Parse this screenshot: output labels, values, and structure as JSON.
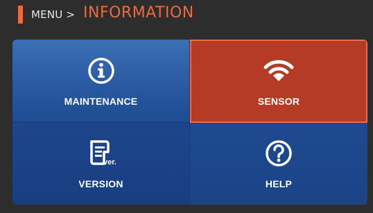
{
  "header": {
    "breadcrumb": "MENU >",
    "title": "INFORMATION",
    "accent_color": "#ef6a3a"
  },
  "tiles": [
    {
      "label": "MAINTENANCE",
      "icon": "info-icon",
      "selected": false
    },
    {
      "label": "SENSOR",
      "icon": "wifi-signal-icon",
      "selected": true
    },
    {
      "label": "VERSION",
      "icon": "version-document-icon",
      "selected": false
    },
    {
      "label": "HELP",
      "icon": "help-question-icon",
      "selected": false
    }
  ],
  "colors": {
    "tile_blue": "#2a5aa2",
    "tile_selected": "#b63b26",
    "selected_border": "#f06a4c",
    "background": "#2d2d2d"
  },
  "version_icon_text": "ver."
}
